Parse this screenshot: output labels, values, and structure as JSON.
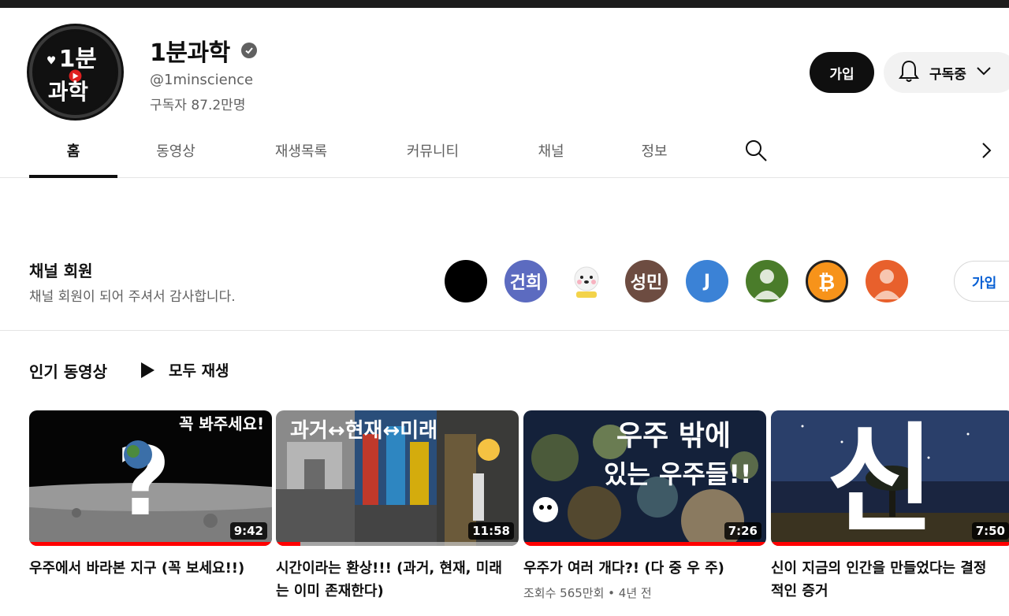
{
  "channel": {
    "name": "1분과학",
    "handle": "@1minscience",
    "subscribers": "구독자 87.2만명",
    "logo_text_top": "1분",
    "logo_text_bottom": "과학"
  },
  "header_buttons": {
    "join": "가입",
    "subscribed": "구독중"
  },
  "tabs": [
    {
      "label": "홈",
      "active": true
    },
    {
      "label": "동영상"
    },
    {
      "label": "재생목록"
    },
    {
      "label": "커뮤니티"
    },
    {
      "label": "채널"
    },
    {
      "label": "정보"
    }
  ],
  "members": {
    "title": "채널 회원",
    "subtitle": "채널 회원이 되어 주셔서 감사합니다.",
    "join_label": "가입",
    "avatars": [
      {
        "text": "",
        "color": "#000000"
      },
      {
        "text": "건희",
        "color": "#5c6bc0"
      },
      {
        "text": "",
        "color": "#ffffff"
      },
      {
        "text": "성민",
        "color": "#6d4c41"
      },
      {
        "text": "J",
        "color": "#3b82d6"
      },
      {
        "text": "",
        "color": "#4a7c2a"
      },
      {
        "text": "",
        "color": "#f7931a"
      },
      {
        "text": "",
        "color": "#e8602c"
      }
    ]
  },
  "popular": {
    "title": "인기 동영상",
    "play_all": "모두 재생"
  },
  "videos": [
    {
      "title": "우주에서 바라본 지구 (꼭 보세요!!)",
      "duration": "9:42",
      "thumb_text": "꼭 봐주세요!",
      "progress": 1.0,
      "meta": ""
    },
    {
      "title": "시간이라는 환상!!! (과거, 현재, 미래는 이미 존재한다)",
      "duration": "11:58",
      "thumb_text": "과거↔현재↔미래",
      "progress": 0.1,
      "meta": ""
    },
    {
      "title": "우주가 여러 개다?! (다 중 우 주)",
      "duration": "7:26",
      "thumb_text_1": "우주 밖에",
      "thumb_text_2": "있는 우주들!!",
      "progress": 1.0,
      "meta": "조회수 565만회 • 4년 전"
    },
    {
      "title": "신이 지금의 인간을 만들었다는 결정적인 증거",
      "duration": "7:50",
      "thumb_text": "신",
      "progress": 1.0,
      "meta": ""
    }
  ]
}
